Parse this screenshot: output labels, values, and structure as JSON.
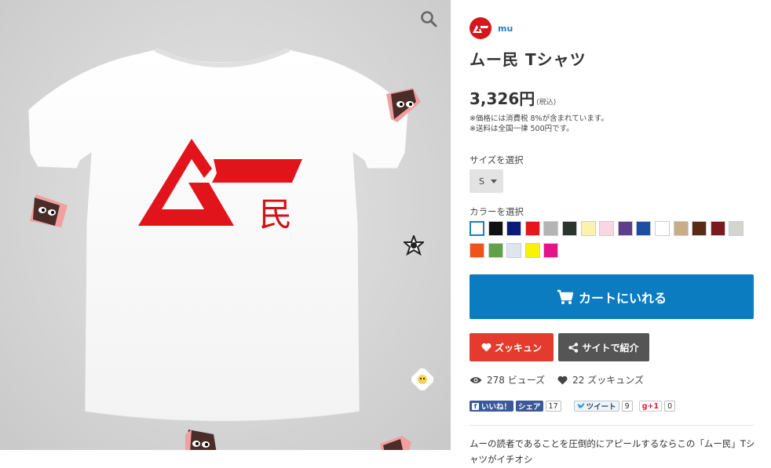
{
  "gallery": {
    "zoom_icon": "search-icon",
    "shirt_logo_kanji": "民"
  },
  "shop": {
    "name": "mu",
    "logo_icon": "mu-logo-icon",
    "brand_color": "#d7161c"
  },
  "product": {
    "title": "ムー民 Tシャツ",
    "price": "3,326円",
    "tax_label": "(税込)",
    "notes": [
      "※価格には消費税 8%が含まれています。",
      "※送料は全国一律 500円です。"
    ]
  },
  "size": {
    "label": "サイズを選択",
    "selected": "S"
  },
  "color": {
    "label": "カラーを選択",
    "swatches": [
      "#ffffff",
      "#111111",
      "#0a1a7a",
      "#e8151b",
      "#b4b4b4",
      "#2c342e",
      "#fbf3a9",
      "#fad5e3",
      "#5e3d8c",
      "#1c4fa0",
      "#ffffff",
      "#c8ad87",
      "#5a2a15",
      "#7a1a1e",
      "#d3d6cc",
      "#f05218",
      "#5fa248",
      "#dde6ee",
      "#f9f200",
      "#e5138a"
    ],
    "selected_index": 0
  },
  "actions": {
    "cart_label": "カートにいれる",
    "cart_icon": "cart-icon",
    "favorite_label": "ズッキュン",
    "favorite_icon": "heart-icon",
    "share_label": "サイトで紹介",
    "share_icon": "share-icon",
    "accent_color": "#0c7cc0",
    "favorite_color": "#e53a2e"
  },
  "stats": {
    "views": "278 ビューズ",
    "likes": "22 ズッキュンズ"
  },
  "social": {
    "fb_like": "いいね！",
    "fb_share": "シェア",
    "fb_share_count": "17",
    "tweet": "ツイート",
    "tweet_count": "9",
    "gplus": "g+1",
    "gplus_count": "0"
  },
  "description": "ムーの読者であることを圧倒的にアピールするならこの「ムー民」Tシャツがイチオシ"
}
